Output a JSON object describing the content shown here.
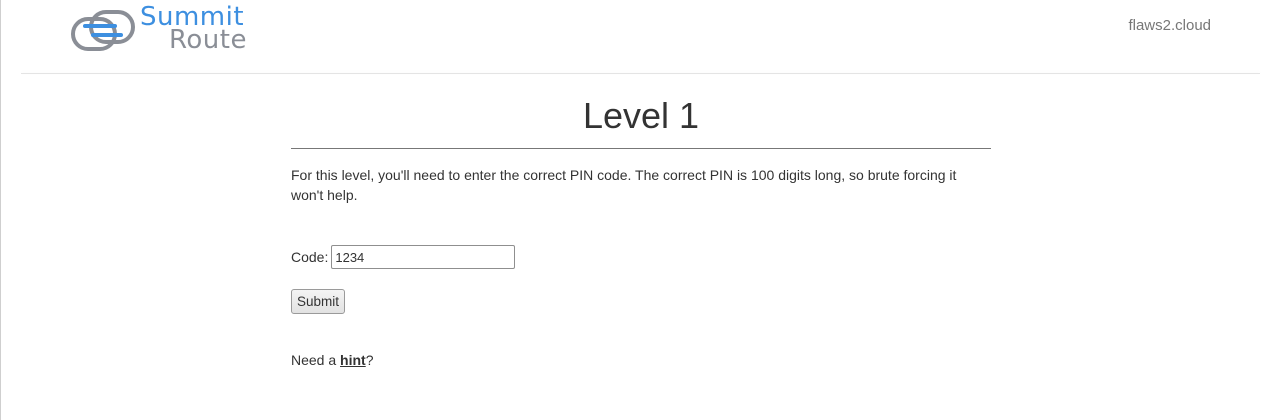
{
  "brand": {
    "word_1": "Summit",
    "word_2": "Route",
    "color_blue": "#3d8fe0",
    "color_gray": "#8a8e96",
    "logo_icon": "summit-route-logo-icon"
  },
  "nav": {
    "site_link": "flaws2.cloud"
  },
  "main": {
    "title": "Level 1",
    "description": "For this level, you'll need to enter the correct PIN code. The correct PIN is 100 digits long, so brute forcing it won't help.",
    "code_label": "Code:",
    "code_value": "1234",
    "submit_label": "Submit",
    "hint_prefix": "Need a ",
    "hint_link": "hint",
    "hint_suffix": "?"
  }
}
